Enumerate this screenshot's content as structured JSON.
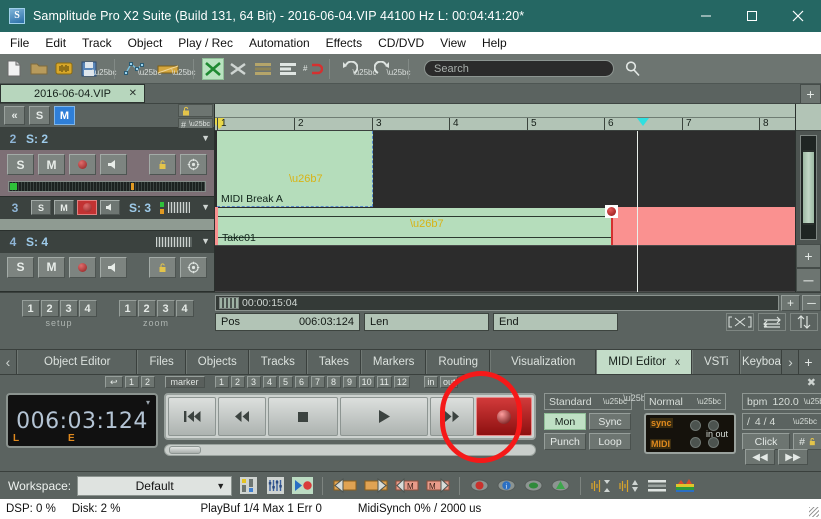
{
  "titlebar": {
    "title": "Samplitude Pro X2 Suite (Build 131, 64 Bit)  -  2016-06-04.VIP   44100 Hz L: 00:04:41:20*",
    "minimize": "─",
    "maximize": "☐",
    "close": "✕",
    "app_icon": "samplitude-icon"
  },
  "menu": [
    "File",
    "Edit",
    "Track",
    "Object",
    "Play / Rec",
    "Automation",
    "Effects",
    "CD/DVD",
    "View",
    "Help"
  ],
  "toolbar": {
    "search_placeholder": "Search",
    "search_value": "",
    "buttons": [
      "new-project-icon",
      "open-project-icon",
      "load-audio-icon",
      "save-icon",
      "envelope-icon",
      "object-icon",
      "crossfade-icon",
      "shuffle-icon",
      "grid-list-icon",
      "align-icon",
      "snap-icon",
      "undo-icon",
      "redo-icon"
    ]
  },
  "vip_tab": {
    "label": "2016-06-04.VIP",
    "close": "✕",
    "add": "+"
  },
  "arranger": {
    "head_toolbar": {
      "collapse": "«",
      "solo": "S",
      "mute": "M",
      "lock": "🔓",
      "fx": "▼",
      "grid": "#"
    },
    "tracks": [
      {
        "number": "2",
        "name": "S: 2",
        "type": "midi",
        "buttons": [
          "S",
          "M",
          "rec",
          "speaker"
        ],
        "right_buttons": [
          "lock-icon",
          "fx-icon"
        ],
        "caret": "▼"
      },
      {
        "number": "3",
        "name": "S: 3",
        "type": "audio-rec",
        "buttons": [
          "S",
          "M",
          "rec",
          "speaker"
        ],
        "rec_armed": true,
        "caret": "▼"
      },
      {
        "number": "4",
        "name": "S: 4",
        "type": "audio",
        "buttons": [
          "S",
          "M",
          "rec",
          "speaker"
        ],
        "right_buttons": [
          "lock-icon",
          "fx-icon"
        ],
        "caret": "▼"
      }
    ],
    "ruler_bars": [
      "1",
      "2",
      "3",
      "4",
      "5",
      "6",
      "7",
      "8"
    ],
    "objects": [
      {
        "name": "MIDI Break A",
        "track": 2,
        "kind": "midi"
      },
      {
        "name": "Take01",
        "track": 3,
        "kind": "audio"
      }
    ],
    "rail": {
      "zoom_in": "+",
      "zoom_out": "─"
    }
  },
  "lower": {
    "setup": {
      "buttons": [
        "1",
        "2",
        "3",
        "4"
      ],
      "label": "setup"
    },
    "zoom": {
      "buttons": [
        "1",
        "2",
        "3",
        "4"
      ],
      "label": "zoom"
    },
    "range_time": "00:00:15:04",
    "range_plus": "+",
    "range_minus": "─",
    "pos_label": "Pos",
    "pos_value": "006:03:124",
    "len_label": "Len",
    "len_value": "",
    "end_label": "End",
    "end_value": "",
    "icons": [
      "range-icon",
      "swap-horizontal-icon",
      "swap-vertical-icon"
    ]
  },
  "manager_tabs": {
    "prev": "‹",
    "next": "›",
    "add": "+",
    "items": [
      {
        "label": "Object Editor",
        "active": false
      },
      {
        "label": "Files",
        "active": false
      },
      {
        "label": "Objects",
        "active": false
      },
      {
        "label": "Tracks",
        "active": false
      },
      {
        "label": "Takes",
        "active": false
      },
      {
        "label": "Markers",
        "active": false
      },
      {
        "label": "Routing",
        "active": false
      },
      {
        "label": "Visualization",
        "active": false
      },
      {
        "label": "MIDI Editor",
        "active": true,
        "close": "x"
      },
      {
        "label": "VSTi",
        "active": false
      },
      {
        "label": "Keyboa",
        "active": false
      }
    ]
  },
  "transport": {
    "marker_bar": {
      "back": "↩",
      "range_buttons": [
        "1",
        "2"
      ],
      "marker_label": "marker",
      "marker_numbers": [
        "1",
        "2",
        "3",
        "4",
        "5",
        "6",
        "7",
        "8",
        "9",
        "10",
        "11",
        "12"
      ],
      "in": "in",
      "out": "out",
      "close": "✖"
    },
    "lcd": {
      "value": "006:03:124",
      "left_tag": "L",
      "mid_tag": "E",
      "caret": "▾"
    },
    "buttons": {
      "rewind_start": "⏮",
      "rewind": "⏪",
      "stop": "■",
      "play": "▶",
      "forward": "⏩",
      "record": "record-icon"
    },
    "mode_dropdown": "Standard",
    "mon_button": "Mon",
    "sync_button": "Sync",
    "punch_button": "Punch",
    "loop_button": "Loop",
    "normal_dropdown": "Normal",
    "sync_panel": {
      "sync_label": "sync",
      "midi_label": "MIDI",
      "in": "in",
      "out": "out"
    },
    "bpm_label": "bpm",
    "bpm_value": "120.0",
    "sig_label": "/",
    "sig_value": "4 / 4",
    "click_button": "Click",
    "grid_button": "#",
    "lock_icon": "lock-icon",
    "jog_prev": "◀◀",
    "jog_next": "▶▶"
  },
  "workspace": {
    "label": "Workspace:",
    "value": "Default",
    "caret": "▼",
    "icons": [
      "mixer-icon",
      "eq-icon",
      "record-monitor-icon",
      "marker-left-icon",
      "marker-right-icon",
      "marker-m-left-icon",
      "marker-m-right-icon",
      "mute-view-icon",
      "info-view-icon",
      "eye-view-icon",
      "object-view-icon",
      "wave-vert-icon",
      "wave-horiz-icon",
      "lanes-icon",
      "spectrum-icon"
    ]
  },
  "statusbar": {
    "dsp": "DSP: 0 %",
    "disk": "Disk:  2 %",
    "playbuf": "PlayBuf 1/4  Max 1  Err 0",
    "midisynch": "MidiSynch  0% / 2000 us"
  },
  "colors": {
    "title_bg": "#256763",
    "accent_green": "#b5ddbb",
    "record_red": "#fa9190",
    "highlight_red": "#f51919",
    "panel_bg": "#5b6360"
  }
}
